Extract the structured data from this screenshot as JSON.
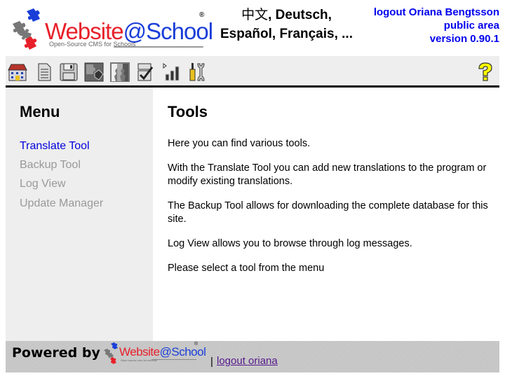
{
  "header": {
    "logo": {
      "brand_part1": "Website",
      "brand_part2": "@School",
      "registered": "®",
      "tagline": "Open-Source CMS for Schools"
    },
    "languages": {
      "line1_zh": "中文",
      "line1_rest": ", Deutsch,",
      "line2": "Español, Français, ..."
    },
    "user": {
      "logout_label": "logout Oriana Bengtsson",
      "area_label": "public area",
      "version_label": "version 0.90.1"
    }
  },
  "toolbar": {
    "items": [
      {
        "name": "start-center",
        "icon": "school-building-icon"
      },
      {
        "name": "pages",
        "icon": "document-icon"
      },
      {
        "name": "files",
        "icon": "floppy-disk-icon"
      },
      {
        "name": "modules",
        "icon": "puzzle-icon"
      },
      {
        "name": "account-manager",
        "icon": "users-icon"
      },
      {
        "name": "configuration",
        "icon": "checklist-icon"
      },
      {
        "name": "statistics",
        "icon": "bar-chart-icon"
      },
      {
        "name": "tools",
        "icon": "tools-icon"
      }
    ],
    "help_icon": "help-question-icon"
  },
  "sidebar": {
    "title": "Menu",
    "items": [
      {
        "label": "Translate Tool",
        "active": true
      },
      {
        "label": "Backup Tool",
        "active": false
      },
      {
        "label": "Log View",
        "active": false
      },
      {
        "label": "Update Manager",
        "active": false
      }
    ]
  },
  "content": {
    "title": "Tools",
    "paragraphs": [
      "Here you can find various tools.",
      "With the Translate Tool you can add new translations to the program or modify existing translations.",
      "The Backup Tool allows for downloading the complete database for this site.",
      "Log View allows you to browse through log messages.",
      "Please select a tool from the menu"
    ]
  },
  "footer": {
    "powered_by": "Powered by",
    "logo_part1": "Website",
    "logo_part2": "@School",
    "logo_registered": "®",
    "logo_tagline": "Open source cms for schools",
    "separator": "|",
    "logout_link": "logout oriana"
  },
  "colors": {
    "link_blue": "#0000ee",
    "menu_active": "#0000dd",
    "menu_inactive": "#999999",
    "panel_gray": "#eeeeee",
    "footer_gray": "#c8c8c8",
    "visited_link": "#551a8b"
  }
}
